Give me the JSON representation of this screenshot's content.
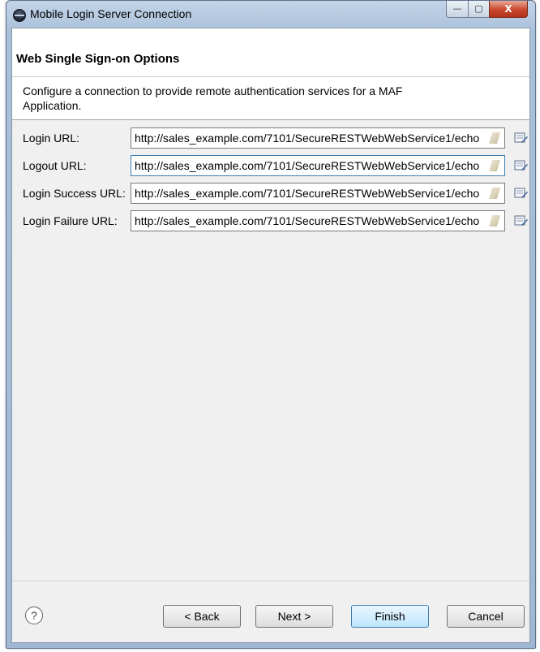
{
  "window": {
    "title": "Mobile Login Server Connection",
    "controls": {
      "minimize": "—",
      "maximize": "▢",
      "close": "X"
    }
  },
  "header": {
    "title": "Web Single Sign-on Options",
    "description": "Configure a connection to provide remote authentication services for a MAF Application."
  },
  "form": {
    "rows": [
      {
        "label": "Login URL:",
        "value": "http://sales_example.com/7101/SecureRESTWebWebService1/echo"
      },
      {
        "label": "Logout URL:",
        "value": "http://sales_example.com/7101/SecureRESTWebWebService1/echo"
      },
      {
        "label": "Login Success URL:",
        "value": "http://sales_example.com/7101/SecureRESTWebWebService1/echo"
      },
      {
        "label": "Login Failure URL:",
        "value": "http://sales_example.com/7101/SecureRESTWebWebService1/echo"
      }
    ]
  },
  "footer": {
    "help": "?",
    "back": "< Back",
    "next": "Next >",
    "finish": "Finish",
    "cancel": "Cancel"
  }
}
